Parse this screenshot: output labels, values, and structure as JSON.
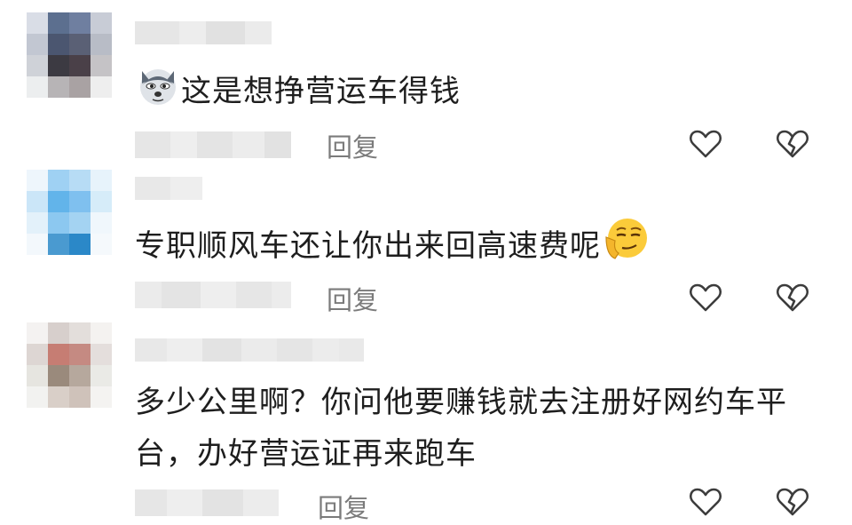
{
  "comments": [
    {
      "text": "这是想挣营运车得钱",
      "reply_label": "回复",
      "leading_emoji": "wolf-emoji",
      "trailing_emoji": ""
    },
    {
      "text": "专职顺风车还让你出来回高速费呢",
      "reply_label": "回复",
      "leading_emoji": "",
      "trailing_emoji": "smirk-emoji"
    },
    {
      "text_line1": "多少公里啊？你问他要赚钱就去注册好网约车平",
      "text_line2": "台，办好营运证再来跑车",
      "reply_label": "回复"
    }
  ],
  "icons": {
    "like": "heart-outline-icon",
    "dislike": "broken-heart-outline-icon"
  }
}
